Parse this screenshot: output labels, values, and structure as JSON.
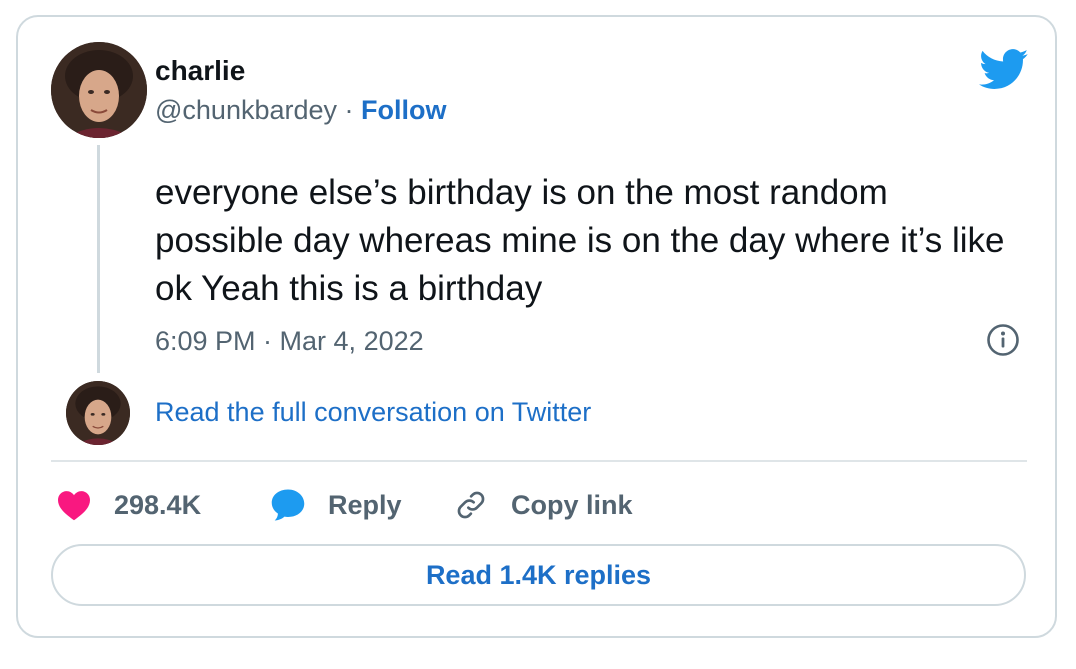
{
  "author": {
    "name": "charlie",
    "handle": "@chunkbardey",
    "separator": "·",
    "follow_label": "Follow"
  },
  "tweet": {
    "text": "everyone else’s birthday is on the most random possible day whereas mine is on the day where it’s like ok Yeah this is a birthday",
    "timestamp": "6:09 PM · Mar 4, 2022"
  },
  "conversation_link": "Read the full conversation on Twitter",
  "actions": {
    "likes_count": "298.4K",
    "reply_label": "Reply",
    "copy_link_label": "Copy link"
  },
  "read_replies_label": "Read 1.4K replies",
  "icons": {
    "brand": "twitter-bird-icon",
    "info": "info-icon",
    "like": "heart-icon",
    "reply": "speech-bubble-icon",
    "copy": "link-icon"
  },
  "colors": {
    "link_blue": "#1d6fc7",
    "twitter_blue": "#1d9bf0",
    "heart_pink": "#f91880",
    "text_primary": "#0f1419",
    "text_secondary": "#536471",
    "border": "#cfd9de"
  }
}
